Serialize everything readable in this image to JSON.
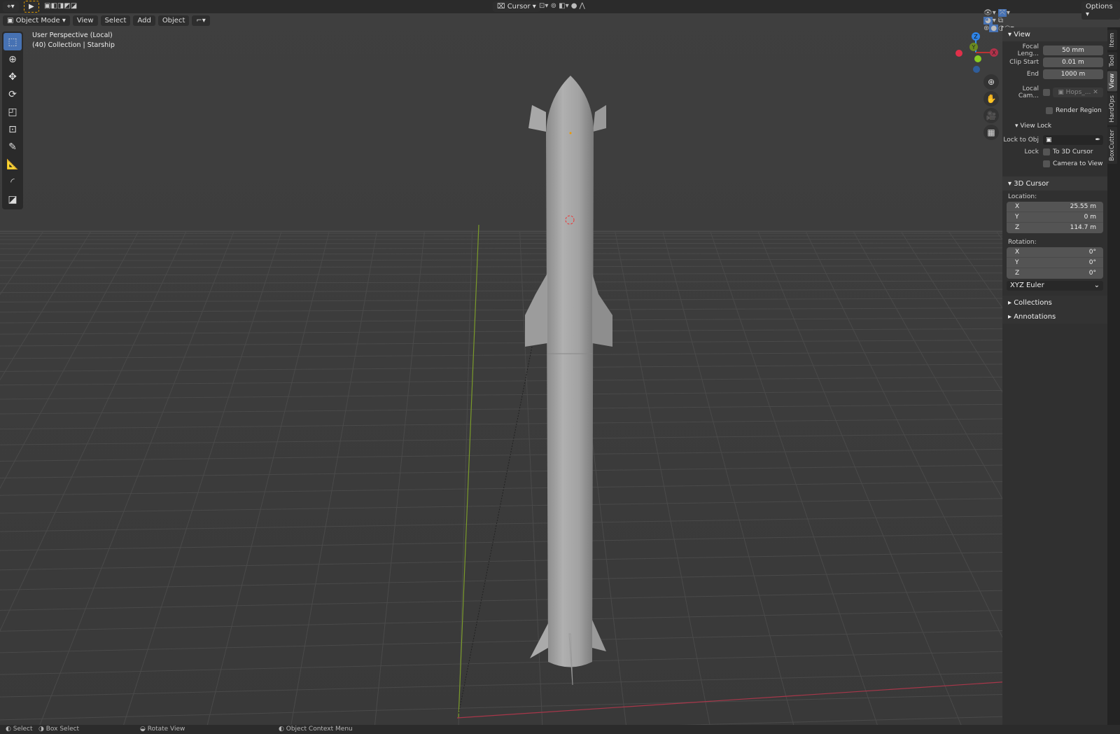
{
  "topbar": {
    "center_pivot": "Cursor",
    "options": "Options"
  },
  "header": {
    "mode": "Object Mode",
    "menus": [
      "View",
      "Select",
      "Add",
      "Object"
    ]
  },
  "overlay": {
    "line1": "User Perspective (Local)",
    "line2": "(40) Collection | Starship"
  },
  "gizmo": {
    "z": "Z",
    "y": "Y",
    "x": "X"
  },
  "npanel": {
    "view": {
      "title": "View",
      "focal_label": "Focal Leng...",
      "focal": "50 mm",
      "clip_start_label": "Clip Start",
      "clip_start": "0.01 m",
      "end_label": "End",
      "end": "1000 m",
      "local_cam_label": "Local Cam...",
      "local_cam": "Hops_...",
      "render_region": "Render Region"
    },
    "view_lock": {
      "title": "View Lock",
      "lock_obj": "Lock to Obj",
      "lock": "Lock",
      "to_cursor": "To 3D Cursor",
      "cam_to_view": "Camera to View"
    },
    "cursor": {
      "title": "3D Cursor",
      "location": "Location:",
      "lx": "25.55 m",
      "ly": "0 m",
      "lz": "114.7 m",
      "rotation": "Rotation:",
      "rx": "0°",
      "ry": "0°",
      "rz": "0°",
      "mode": "XYZ Euler",
      "ax": "X",
      "ay": "Y",
      "az": "Z"
    },
    "collections": "Collections",
    "annotations": "Annotations"
  },
  "tabs": [
    "Item",
    "Tool",
    "View",
    "HardOps",
    "BoxCutter"
  ],
  "status": {
    "select": "Select",
    "box_select": "Box Select",
    "rotate": "Rotate View",
    "context": "Object Context Menu"
  }
}
